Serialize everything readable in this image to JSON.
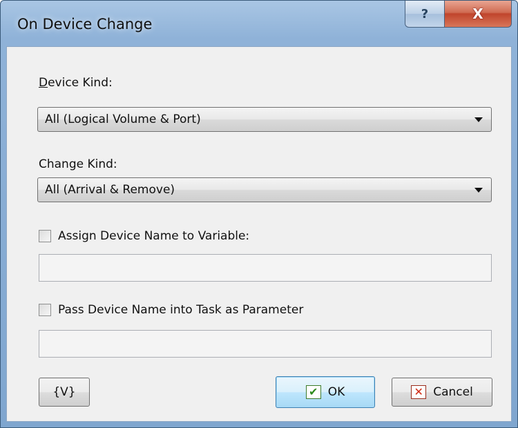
{
  "window": {
    "title": "On Device Change",
    "help_label": "?",
    "close_label": "X"
  },
  "device_kind": {
    "label_accel": "D",
    "label_rest": "evice Kind:",
    "value": "All (Logical Volume & Port)"
  },
  "change_kind": {
    "label": "Change Kind:",
    "value": "All (Arrival & Remove)"
  },
  "assign_variable": {
    "label": "Assign Device Name to Variable:",
    "checked": false,
    "value": ""
  },
  "pass_parameter": {
    "label": "Pass Device Name into Task as Parameter",
    "checked": false,
    "value": ""
  },
  "buttons": {
    "variables": "{V}",
    "ok": "OK",
    "ok_icon": "✔",
    "cancel": "Cancel",
    "cancel_icon": "✕"
  }
}
